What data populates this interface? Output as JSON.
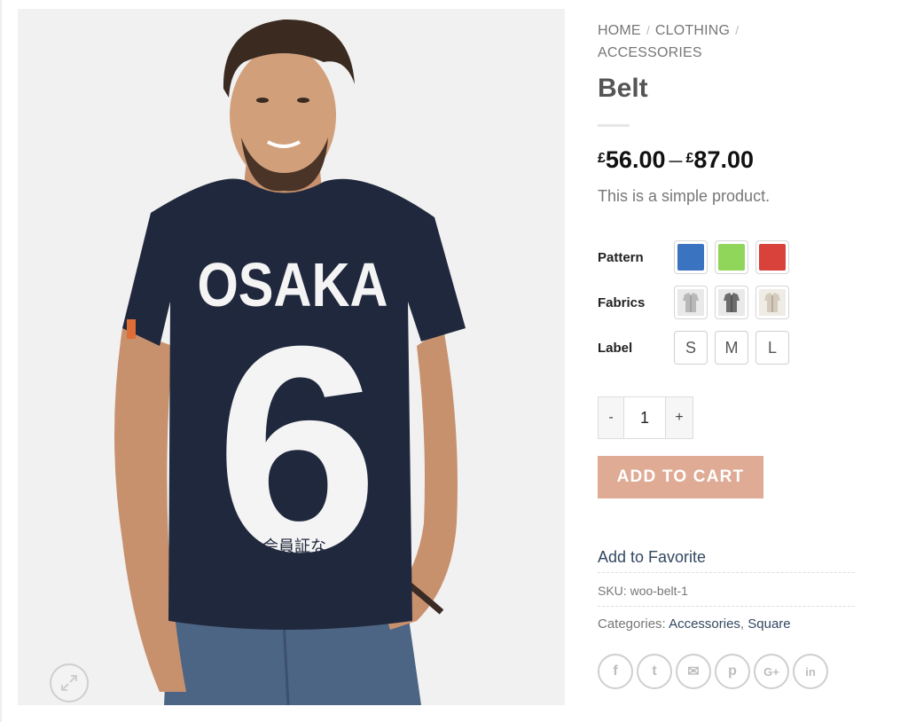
{
  "breadcrumb": {
    "items": [
      "HOME",
      "CLOTHING",
      "ACCESSORIES"
    ],
    "separator": "/"
  },
  "product": {
    "title": "Belt",
    "price_currency": "£",
    "price_min": "56.00",
    "price_max": "87.00",
    "price_dash": "–",
    "description": "This is a simple product.",
    "image": {
      "shirt_text": "OSAKA",
      "shirt_number": "6",
      "shirt_subtext": "会員証な"
    }
  },
  "attributes": {
    "pattern": {
      "label": "Pattern",
      "swatches": [
        {
          "name": "blue",
          "color": "#3a73c0"
        },
        {
          "name": "green",
          "color": "#8fd65a"
        },
        {
          "name": "red",
          "color": "#d9413b"
        }
      ]
    },
    "fabrics": {
      "label": "Fabrics",
      "swatches": [
        {
          "name": "shirt-light-gray"
        },
        {
          "name": "shirt-dark-gray"
        },
        {
          "name": "shirt-beige"
        }
      ]
    },
    "label": {
      "label": "Label",
      "options": [
        "S",
        "M",
        "L"
      ]
    }
  },
  "cart": {
    "minus": "-",
    "quantity": "1",
    "plus": "+",
    "add_label": "ADD TO CART",
    "button_color": "#dfab95"
  },
  "meta": {
    "favorite": "Add to Favorite",
    "sku_label": "SKU:",
    "sku_value": "woo-belt-1",
    "categories_label": "Categories:",
    "categories": [
      "Accessories",
      "Square"
    ],
    "categories_sep": ","
  },
  "share": {
    "icons": [
      "facebook-icon",
      "twitter-icon",
      "email-icon",
      "pinterest-icon",
      "google-plus-icon",
      "linkedin-icon"
    ],
    "glyphs": [
      "f",
      "t",
      "✉",
      "p",
      "G+",
      "in"
    ]
  }
}
